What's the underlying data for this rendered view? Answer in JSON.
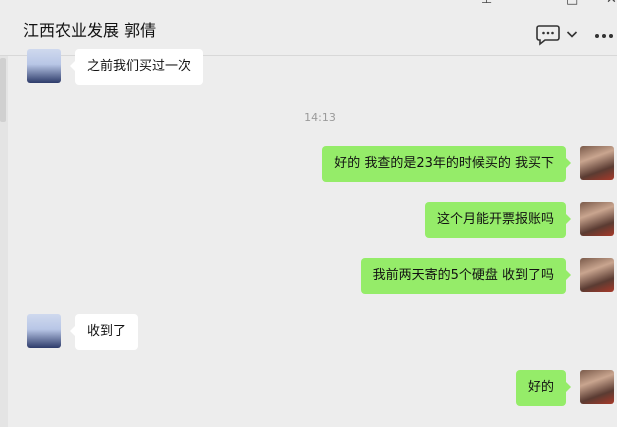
{
  "window": {
    "pin_icon": "pin-icon",
    "minimize_glyph": "–",
    "maximize_glyph": "□",
    "close_glyph": "✕"
  },
  "header": {
    "title": "江西农业发展 郭倩",
    "icons": [
      "chat-bubble-icon",
      "chevron-down-icon",
      "more-icon"
    ]
  },
  "timestamp": "14:13",
  "colors": {
    "background": "#ededed",
    "incoming_bubble": "#ffffff",
    "outgoing_bubble": "#95ec69"
  },
  "messages": [
    {
      "from": "other",
      "text": "之前我们买过一次"
    },
    {
      "from": "me",
      "text": "好的 我查的是23年的时候买的 我买下"
    },
    {
      "from": "me",
      "text": "这个月能开票报账吗"
    },
    {
      "from": "me",
      "text": "我前两天寄的5个硬盘 收到了吗"
    },
    {
      "from": "other",
      "text": "收到了"
    },
    {
      "from": "me",
      "text": "好的"
    }
  ]
}
